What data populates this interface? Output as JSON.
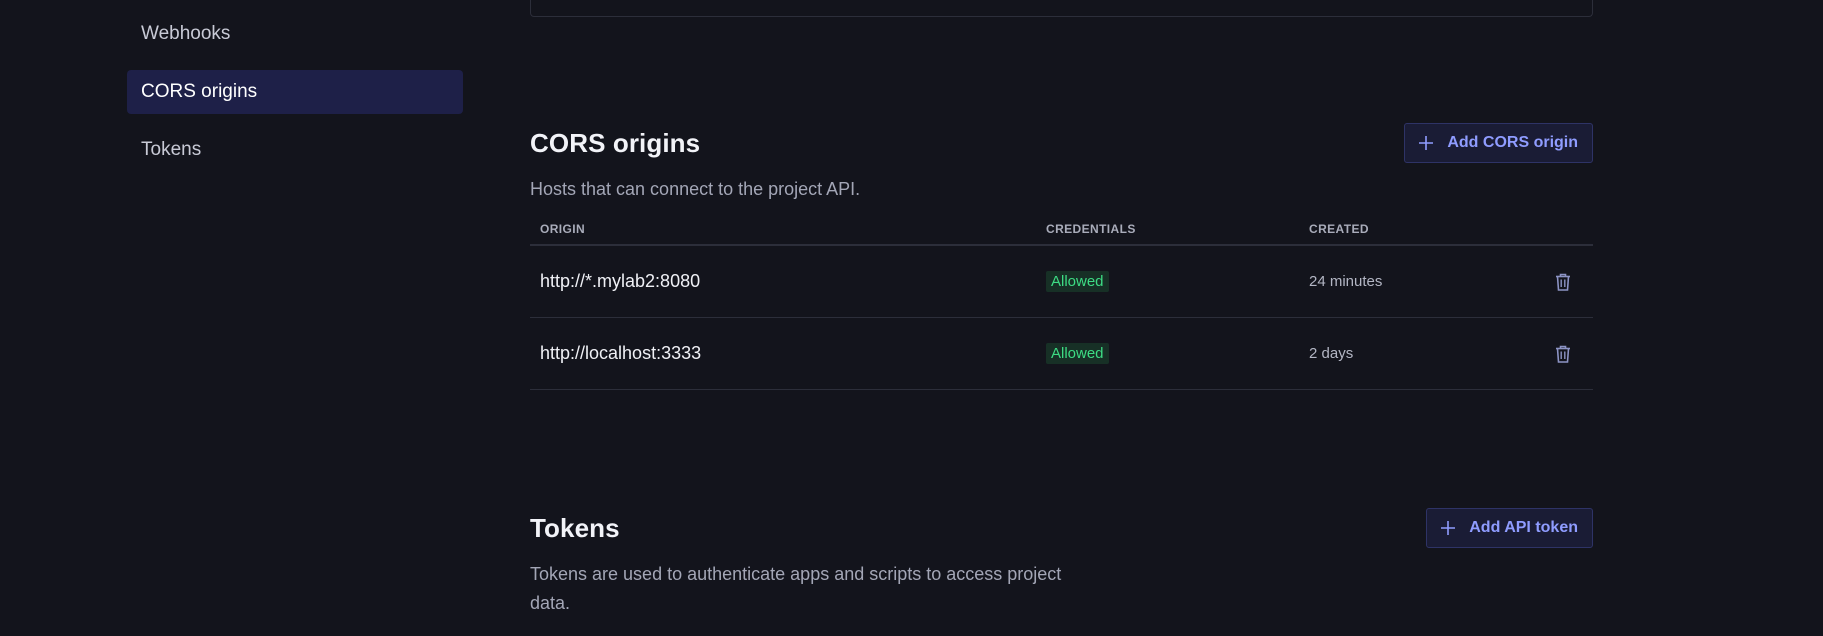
{
  "sidebar": {
    "items": [
      {
        "label": "Webhooks",
        "active": false
      },
      {
        "label": "CORS origins",
        "active": true
      },
      {
        "label": "Tokens",
        "active": false
      }
    ]
  },
  "cors": {
    "title": "CORS origins",
    "add_label": "Add CORS origin",
    "description": "Hosts that can connect to the project API.",
    "columns": {
      "origin": "ORIGIN",
      "credentials": "CREDENTIALS",
      "created": "CREATED"
    },
    "rows": [
      {
        "origin": "http://*.mylab2:8080",
        "credentials": "Allowed",
        "created": "24 minutes"
      },
      {
        "origin": "http://localhost:3333",
        "credentials": "Allowed",
        "created": "2 days"
      }
    ]
  },
  "tokens": {
    "title": "Tokens",
    "add_label": "Add API token",
    "description": "Tokens are used to authenticate apps and scripts to access project data."
  },
  "colors": {
    "background": "#13141c",
    "accent": "#8f9cff",
    "allowed_badge": "#3ddc84",
    "active_nav": "#1e2048"
  },
  "icons": {
    "add": "plus-icon",
    "delete": "trash-icon"
  }
}
